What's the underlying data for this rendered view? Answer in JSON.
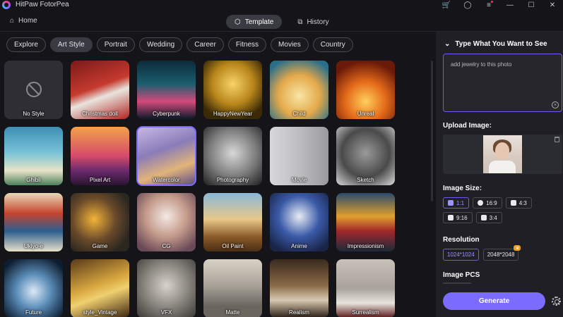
{
  "app": {
    "name": "HitPaw FotorPea"
  },
  "nav": {
    "home": "Home",
    "tabs": [
      {
        "label": "Template"
      },
      {
        "label": "History"
      }
    ]
  },
  "categories": [
    "Explore",
    "Art Style",
    "Portrait",
    "Wedding",
    "Career",
    "Fitness",
    "Movies",
    "Country"
  ],
  "selected_category": "Art Style",
  "styles": [
    {
      "label": "No Style",
      "bg": "#2e2e34"
    },
    {
      "label": "Christmas doll",
      "bg": "linear-gradient(160deg,#7a1a1a,#c63a2e 45%,#e9e4de 60%,#b0241f)"
    },
    {
      "label": "Cyberpunk",
      "bg": "linear-gradient(180deg,#0d2a3a,#1a5e6e 40%,#d24a7a 70%,#0c1a2a)"
    },
    {
      "label": "HappyNewYear",
      "bg": "radial-gradient(circle at 50% 40%,#f6d36a,#b8861a 45%,#3a2a08 80%)"
    },
    {
      "label": "Child",
      "bg": "radial-gradient(circle at 50% 60%,#f7e6a4,#e5a94a 45%,#2a6f8a 85%)"
    },
    {
      "label": "Unreal",
      "bg": "radial-gradient(circle at 50% 70%,#ffcf5a,#e46a1a 40%,#6a1a08 80%)"
    },
    {
      "label": "Ghibli",
      "bg": "linear-gradient(180deg,#3c8fb5,#7ac3d8 45%,#e8e4c8 75%,#4b7f5a)"
    },
    {
      "label": "Pixel Art",
      "bg": "linear-gradient(180deg,#f2a24a,#d64a6a 50%,#6a2a6e 75%,#2a1430)"
    },
    {
      "label": "Watercolor",
      "bg": "linear-gradient(160deg,#c9b9e6,#8a7cb8 40%,#e2b47a 70%,#5a4a88)"
    },
    {
      "label": "Photography",
      "bg": "radial-gradient(circle at 50% 45%,#d8d8d8,#7a7a7a 55%,#1e1e1e)"
    },
    {
      "label": "Movie",
      "bg": "linear-gradient(90deg,#d8d8da,#bdbdc0 50%,#9a9a9e)"
    },
    {
      "label": "Sketch",
      "bg": "radial-gradient(circle at 50% 45%,#9a9a9a,#4a4a4a 55%,#d8d8d8)"
    },
    {
      "label": "Ukiyo-e",
      "bg": "linear-gradient(180deg,#e9d9b6,#c6442e 35%,#2c5d8e 65%,#e8e0c9)"
    },
    {
      "label": "Game",
      "bg": "radial-gradient(circle at 40% 45%,#f2b33a,#6a4a2a 45%,#2a2620 80%)"
    },
    {
      "label": "CG",
      "bg": "radial-gradient(circle at 50% 40%,#f4e9e4,#c49a8a 45%,#6a4a58 85%)"
    },
    {
      "label": "Oil Paint",
      "bg": "linear-gradient(180deg,#8ab8d8,#e8c88a 45%,#8a5a2a 75%,#4a2e14)"
    },
    {
      "label": "Anime",
      "bg": "radial-gradient(circle at 50% 40%,#e8ecf4,#3a5aa8 45%,#1a2448 85%)"
    },
    {
      "label": "Impressionism",
      "bg": "linear-gradient(180deg,#2a4a6a,#e0a030 40%,#a0282a 65%,#1a2a3a)"
    },
    {
      "label": "Future",
      "bg": "radial-gradient(circle at 50% 55%,#dbe9f6,#5a8cb8 40%,#0e1e30 85%)"
    },
    {
      "label": "style_Vintage",
      "bg": "linear-gradient(160deg,#5a3a1a,#d8a840 45%,#f0d070 60%,#3a2410)"
    },
    {
      "label": "VFX",
      "bg": "radial-gradient(circle at 50% 45%,#d8d4cc,#8a8680 50%,#3a3834)"
    },
    {
      "label": "Matte",
      "bg": "linear-gradient(180deg,#d8d2c6,#a8a298 45%,#6a665e 80%)"
    },
    {
      "label": "Realism",
      "bg": "linear-gradient(180deg,#3a2a1e,#8a6a48 45%,#d8c8b0 70%,#2a1e16)"
    },
    {
      "label": "Surrealism",
      "bg": "linear-gradient(180deg,#c8c2ba,#a8a29a 50%,#e8e4de 75%,#5a1a1a)"
    }
  ],
  "selected_style": "Watercolor",
  "panel": {
    "prompt_heading": "Type What You Want to See",
    "prompt_value": "add jewelry to this photo",
    "upload_label": "Upload Image:",
    "size_label": "Image Size:",
    "sizes": [
      {
        "label": "1:1",
        "icon": "instagram-icon",
        "active": true
      },
      {
        "label": "16:9",
        "icon": "facebook-icon",
        "active": false
      },
      {
        "label": "4:3",
        "icon": "twitter-icon",
        "active": false
      },
      {
        "label": "9:16",
        "icon": "instagram-icon",
        "active": false
      },
      {
        "label": "3:4",
        "icon": "twitter-icon",
        "active": false
      }
    ],
    "resolution_label": "Resolution",
    "resolutions": [
      {
        "label": "1024*1024",
        "active": true
      },
      {
        "label": "2048*2048",
        "active": false,
        "badge": "vip-crown-icon"
      }
    ],
    "pcs_label": "Image PCS",
    "generate_label": "Generate"
  },
  "colors": {
    "accent": "#7b6cff",
    "background": "#151519",
    "panel": "#1f1f25"
  }
}
